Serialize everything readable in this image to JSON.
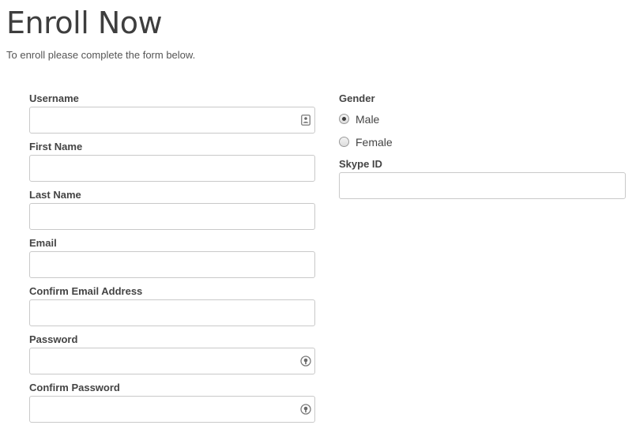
{
  "page": {
    "title": "Enroll Now",
    "subtitle": "To enroll please complete the form below."
  },
  "form": {
    "left_fields": [
      {
        "label": "Username",
        "value": "",
        "placeholder": "",
        "icon": "contact-card-icon"
      },
      {
        "label": "First Name",
        "value": "",
        "placeholder": ""
      },
      {
        "label": "Last Name",
        "value": "",
        "placeholder": ""
      },
      {
        "label": "Email",
        "value": "",
        "placeholder": ""
      },
      {
        "label": "Confirm Email Address",
        "value": "",
        "placeholder": ""
      },
      {
        "label": "Password",
        "value": "",
        "placeholder": "",
        "icon": "password-key-icon"
      },
      {
        "label": "Confirm Password",
        "value": "",
        "placeholder": "",
        "icon": "password-key-icon"
      }
    ],
    "gender": {
      "label": "Gender",
      "options": [
        {
          "label": "Male",
          "selected": true
        },
        {
          "label": "Female",
          "selected": false
        }
      ]
    },
    "skype": {
      "label": "Skype ID",
      "value": "",
      "placeholder": ""
    }
  },
  "colors": {
    "input_border": "#c9c9c9",
    "label_text": "#444444",
    "title_text": "#3e3e3e"
  }
}
